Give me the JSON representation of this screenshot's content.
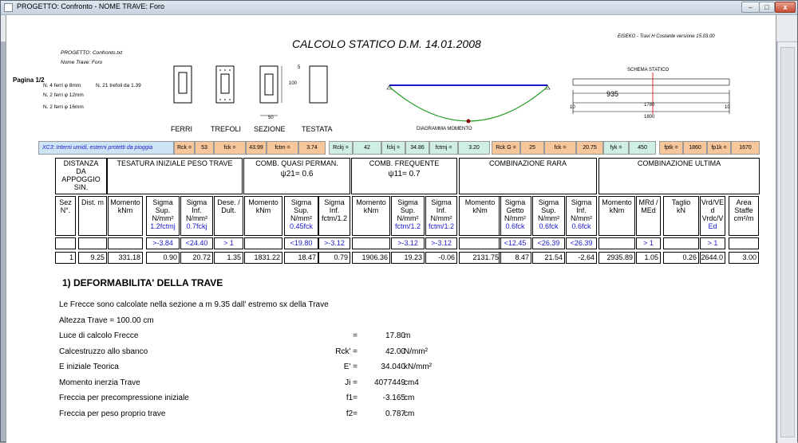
{
  "window": {
    "title": "PROGETTO: Confronto - NOME TRAVE: Foro",
    "minimize": "–",
    "maximize": "□",
    "close": "x"
  },
  "report": {
    "title": "CALCOLO STATICO D.M. 14.01.2008",
    "software": "EISEKO - Travi H Costante versione 15.03.00",
    "page": "Pagina 1/2",
    "project_line": "PROGETTO:  Confronto.txt",
    "beam_line": "Nome Trave:  Foro",
    "rebars": [
      "N. 4 ferri φ 8mm",
      "N. 2 ferri φ 12mm",
      "N. 2 ferri φ 16mm"
    ],
    "strands": "N. 21 trefoli da 1.39",
    "section_labels": [
      "FERRI",
      "TREFOLI",
      "SEZIONE",
      "TESTATA"
    ],
    "dim_5": "5",
    "dim_100": "100",
    "dim_50": "50",
    "diagram_label": "DIAGRAMMA MOMENTO",
    "scheme_label": "SCHEMA STATICO",
    "scheme_span": "935",
    "scheme_mid": "1780",
    "scheme_total": "1800",
    "scheme_left": "10",
    "scheme_right": "10"
  },
  "params": {
    "exposure": "XC3: Interni umidi, esterni protetti da pioggia",
    "items": [
      {
        "label": "Rck =",
        "value": "53"
      },
      {
        "label": "fck =",
        "value": "43.99"
      },
      {
        "label": "fctm =",
        "value": "3.74"
      },
      {
        "label": "Rckj =",
        "value": "42"
      },
      {
        "label": "fckj =",
        "value": "34.86"
      },
      {
        "label": "fctmj =",
        "value": "3.20"
      },
      {
        "label": "Rck G =",
        "value": "25"
      },
      {
        "label": "fck =",
        "value": "20.75"
      },
      {
        "label": "fyk =",
        "value": "450"
      },
      {
        "label": "fptk =",
        "value": "1860"
      },
      {
        "label": "fp1k =",
        "value": "1670"
      }
    ]
  },
  "table": {
    "groups": [
      "DISTANZA DA APPOGGIO SIN.",
      "TESATURA INIZIALE PESO TRAVE",
      "COMB. QUASI PERMAN.",
      "COMB.  FREQUENTE",
      "COMBINAZIONE  RARA",
      "COMBINAZIONE ULTIMA"
    ],
    "psi21": "ψ21= 0.6",
    "psi11": "ψ11= 0.7",
    "headers": [
      {
        "l1": "Sez",
        "l2": "N°.",
        "l3": ""
      },
      {
        "l1": "Dist.  m",
        "l2": "",
        "l3": ""
      },
      {
        "l1": "Momento",
        "l2": "kNm",
        "l3": ""
      },
      {
        "l1": "Sigma",
        "l2": "Sup.",
        "l2b": "N/mm²",
        "l3": "1.2fctmj"
      },
      {
        "l1": "Sigma",
        "l2": "Inf.",
        "l2b": "N/mm²",
        "l3": "0.7fckj"
      },
      {
        "l1": "Dese. /",
        "l2": "Dult.",
        "l3": ""
      },
      {
        "l1": "Momento",
        "l2": "kNm",
        "l3": ""
      },
      {
        "l1": "Sigma",
        "l2": "Sup.",
        "l2b": "N/mm²",
        "l3": "0.45fck"
      },
      {
        "l1": "Sigma",
        "l2": "Inf.",
        "l2b": "fctm/1.2",
        "l3": ""
      },
      {
        "l1": "Momento",
        "l2": "kNm",
        "l3": ""
      },
      {
        "l1": "Sigma",
        "l2": "Sup.",
        "l2b": "N/mm²",
        "l3": "fctm/1.2"
      },
      {
        "l1": "Sigma",
        "l2": "Inf.",
        "l2b": "N/mm²",
        "l3": "fctm/1.2"
      },
      {
        "l1": "Momento",
        "l2": "kNm",
        "l3": ""
      },
      {
        "l1": "Sigma",
        "l2": "Getto",
        "l2b": "N/mm²",
        "l3": "0.6fck"
      },
      {
        "l1": "Sigma",
        "l2": "Sup.",
        "l2b": "N/mm²",
        "l3": "0.6fck"
      },
      {
        "l1": "Sigma",
        "l2": "Inf.",
        "l2b": "N/mm²",
        "l3": "0.6fck"
      },
      {
        "l1": "Momento",
        "l2": "kNm",
        "l3": ""
      },
      {
        "l1": "MRd /",
        "l2": "MEd",
        "l3": ""
      },
      {
        "l1": "Taglio",
        "l2": "kN",
        "l3": ""
      },
      {
        "l1": "Vrd/VE",
        "l2": "d",
        "l2b": "Vrdc/V",
        "l3": "Ed"
      },
      {
        "l1": "Area",
        "l2": "Staffe",
        "l2b": "cm²/m",
        "l3": ""
      }
    ],
    "limits": [
      "",
      "",
      "",
      ">-3.84",
      "<24.40",
      "> 1",
      "",
      "<19.80",
      ">-3.12",
      "",
      ">-3.12",
      ">-3.12",
      "",
      "<12.45",
      "<26.39",
      "<26.39",
      "",
      "> 1",
      "",
      "> 1",
      ""
    ],
    "row": [
      "1",
      "9.25",
      "331.18",
      "0.90",
      "20.72",
      "1.35",
      "1831.22",
      "18.47",
      "0.79",
      "1906.36",
      "19.23",
      "-0.06",
      "2131.75",
      "8.47",
      "21.54",
      "-2.64",
      "2935.89",
      "1.05",
      "0.26",
      "2644.0",
      "3.00"
    ]
  },
  "deform": {
    "heading": "1) DEFORMABILITA' DELLA TRAVE",
    "intro": "Le Frecce sono calcolate nella sezione a m 9.35 dall' estremo sx della Trave",
    "height": "Altezza Trave  = 100.00 cm",
    "rows": [
      {
        "label": "Luce di calcolo Frecce",
        "sym": "=",
        "val": "17.80",
        "unit": "m"
      },
      {
        "label": "Calcestruzzo allo sbanco",
        "sym": "Rck' =",
        "val": "42.00",
        "unit": "N/mm²"
      },
      {
        "label": "E iniziale Teorica",
        "sym": "E' =",
        "val": "34.040",
        "unit": "kN/mm²"
      },
      {
        "label": "Momento inerzia Trave",
        "sym": "Ji =",
        "val": "4077449",
        "unit": "cm4"
      },
      {
        "label": "Freccia per precompressione iniziale",
        "sym": "f1=",
        "val": "-3.165",
        "unit": "cm"
      },
      {
        "label": "Freccia per peso proprio trave",
        "sym": "f2=",
        "val": "0.787",
        "unit": "cm"
      }
    ]
  },
  "colors": {
    "blue_param": "#cde4f5",
    "green_param": "#cfeee4",
    "orange_param": "#f7c69a",
    "limit_blue": "#1a1acc"
  }
}
